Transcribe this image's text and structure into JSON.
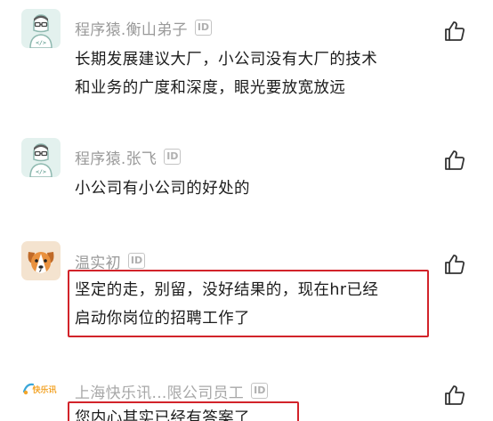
{
  "comments": [
    {
      "username": "程序猿.衡山弟子",
      "badge": "ID",
      "avatar": "programmer-avatar-icon",
      "lines": [
        "长期发展建议大厂，小公司没有大厂的技术",
        "和业务的广度和深度，眼光要放宽放远"
      ],
      "highlighted": false
    },
    {
      "username": "程序猿.张飞",
      "badge": "ID",
      "avatar": "programmer-avatar-icon",
      "lines": [
        "小公司有小公司的好处的"
      ],
      "highlighted": false
    },
    {
      "username": "温实初",
      "badge": "ID",
      "avatar": "dog-avatar-icon",
      "lines": [
        "坚定的走，别留，没好结果的，现在hr已经",
        "启动你岗位的招聘工作了"
      ],
      "highlighted": true
    },
    {
      "username": "上海快乐讯...限公司员工",
      "badge": "ID",
      "avatar_text": "快乐讯",
      "lines": [
        "您内心其实已经有答案了"
      ],
      "highlighted": true
    }
  ],
  "like_icon": "thumbs-up-icon",
  "colors": {
    "highlight": "#d2232a",
    "username": "#9a9a9a",
    "avatar_bg": "#e3f1ee",
    "dog_bg": "#f4e3cf"
  }
}
